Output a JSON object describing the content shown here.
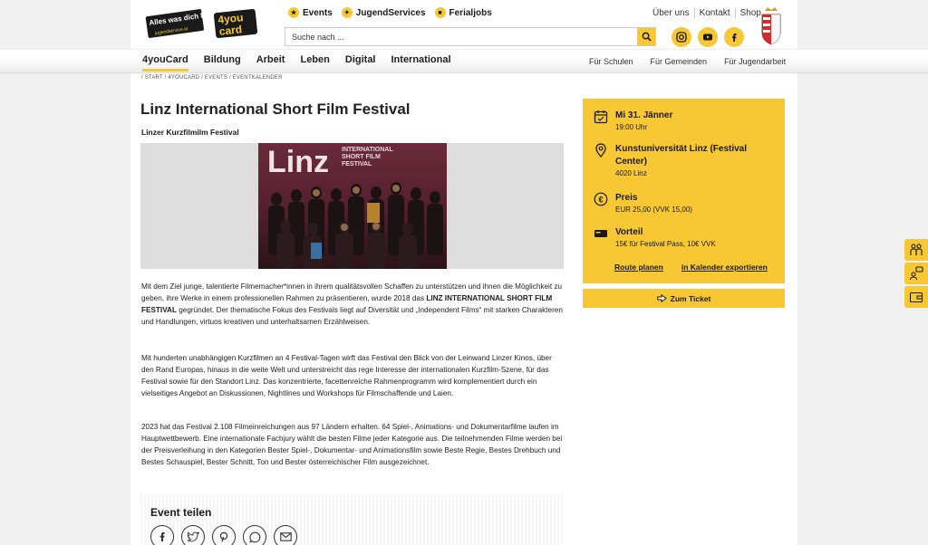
{
  "header": {
    "logo_text": "Alles was dich bewegt!",
    "logo_sub": "jugendservice.at",
    "card_logo": "4you card",
    "toplinks": [
      {
        "label": "Events",
        "icon": "events-icon"
      },
      {
        "label": "JugendServices",
        "icon": "services-icon"
      },
      {
        "label": "Ferialjobs",
        "icon": "jobs-icon"
      }
    ],
    "search_placeholder": "Suche nach ...",
    "rightlinks": [
      "Über uns",
      "Kontakt",
      "Shop"
    ],
    "social": [
      "instagram-icon",
      "youtube-icon",
      "facebook-icon"
    ]
  },
  "nav": {
    "main": [
      "4youCard",
      "Bildung",
      "Arbeit",
      "Leben",
      "Digital",
      "International"
    ],
    "secondary": [
      "Für Schulen",
      "Für Gemeinden",
      "Für Jugendarbeit"
    ]
  },
  "breadcrumb": "/ START / 4YOUCARD / EVENTS / EVENTKALENDER",
  "event": {
    "title": "Linz International Short Film Festival",
    "subtitle": "Linzer Kurzfilmilm Festival",
    "photo_text": "Linz",
    "photo_text2": "INTERNATIONAL SHORT FILM FESTIVAL"
  },
  "body": {
    "p1_a": "Mit dem Ziel junge, talentierte Filmemacher*innen in ihrem qualitätsvollen Schaffen zu unterstützen und ihnen die Möglichkeit zu geben, ihre Werke in einem professionellen Rahmen zu präsentieren, wurde 2018 das ",
    "p1_b": "LINZ INTERNATIONAL SHORT FILM FESTIVAL",
    "p1_c": " gegründet. Der thematische Fokus des Festivals liegt auf Diversität und „Independent Films“ mit starken Charakteren und Handlungen, virtuos kreativen und unterhaltsamen Erzählweisen.",
    "p2": "Mit hunderten unabhängigen Kurzfilmen an 4 Festival-Tagen wirft das Festival den Blick von der Leinwand Linzer Kinos, über den Rand Europas, hinaus in die weite Welt und unterstreicht das rege Interesse der internationalen Kurzfilm-Szene, für das Festival sowie für den Standort Linz. Das konzentrierte, facettenreiche Rahmenprogramm wird komplementiert durch ein vielseitiges Angebot an Diskussionen, Nightlines und Workshops für Filmschaffende und Laien.",
    "p3": "2023 hat das Festival 2.108 Filmeinreichungen aus 97 Ländern erhalten. 64 Spiel-, Animations- und Dokumentarfilme laufen im Hauptwettbewerb. Eine internationale Fachjury wählt die besten Filme jeder Kategorie aus. Die teilnehmenden Filme werden bei der Preisverleihung in den Kategorien Bester Spiel-, Dokumentar- und Animationsfilm sowie Beste Regie, Bestes Drehbuch und Bestes Schauspiel, Bester Schnitt, Ton und Bester österreichischer Film ausgezeichnet."
  },
  "share": {
    "title": "Event teilen",
    "icons": [
      "facebook-icon",
      "twitter-icon",
      "pinterest-icon",
      "whatsapp-icon",
      "email-icon"
    ]
  },
  "info": {
    "date_title": "Mi 31. Jänner",
    "date_time": "19:00 Uhr",
    "place_title": "Kunstuniversität Linz (Festival Center)",
    "place_city": "4020 Linz",
    "price_title": "Preis",
    "price_value": "EUR 25,00 (VVK 15,00)",
    "benefit_title": "Vorteil",
    "benefit_value": "15€ für Festival Pass, 10€ VVK",
    "route_link": "Route planen",
    "calendar_link": "in Kalender exportieren",
    "ticket_button": "Zum Ticket"
  },
  "colors": {
    "accent": "#f7c833",
    "text": "#1a1a1a"
  }
}
